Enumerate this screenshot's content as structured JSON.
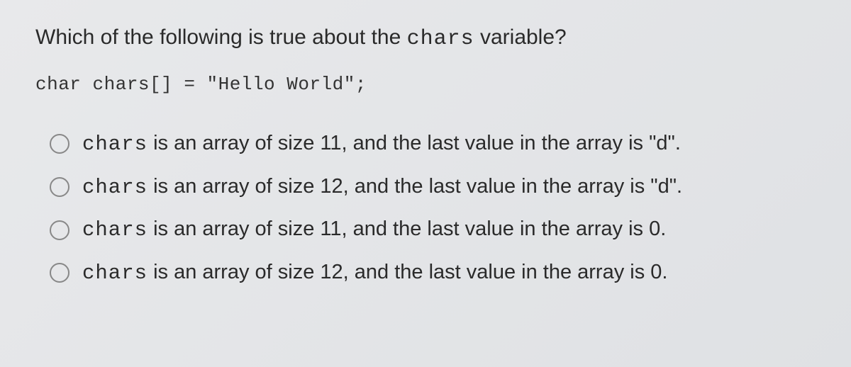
{
  "question": {
    "prefix": "Which of the following is true about the ",
    "code_word": "chars",
    "suffix": " variable?"
  },
  "code_line": "char chars[] = \"Hello World\";",
  "options": [
    {
      "code": "chars",
      "rest": "  is an array of size 11, and the last value in the array is \"d\"."
    },
    {
      "code": "chars",
      "rest": "  is an array of size 12, and the last value in the array is \"d\"."
    },
    {
      "code": "chars",
      "rest": "  is an array of size 11, and the last value in the array is 0."
    },
    {
      "code": "chars",
      "rest": "  is an array of size 12, and the last value in the array is 0."
    }
  ]
}
